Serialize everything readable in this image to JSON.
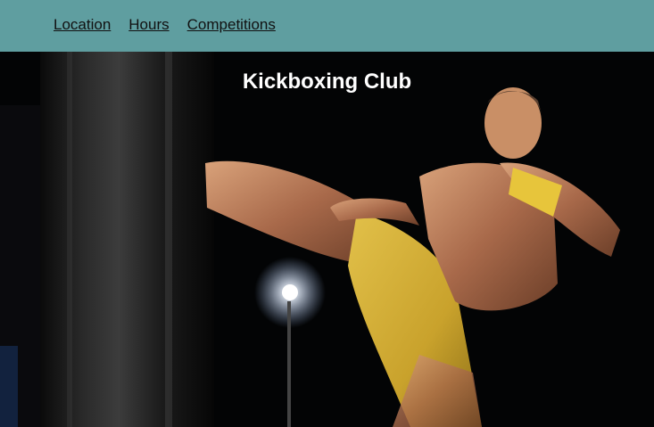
{
  "nav": {
    "items": [
      {
        "label": "Location"
      },
      {
        "label": "Hours"
      },
      {
        "label": "Competitions"
      }
    ]
  },
  "hero": {
    "title": "Kickboxing Club",
    "image_alt": "kickboxer-kicking-heavy-bag-photo"
  },
  "colors": {
    "nav_background": "#5f9ea0",
    "title_text": "#ffffff",
    "link_text": "#111111"
  }
}
